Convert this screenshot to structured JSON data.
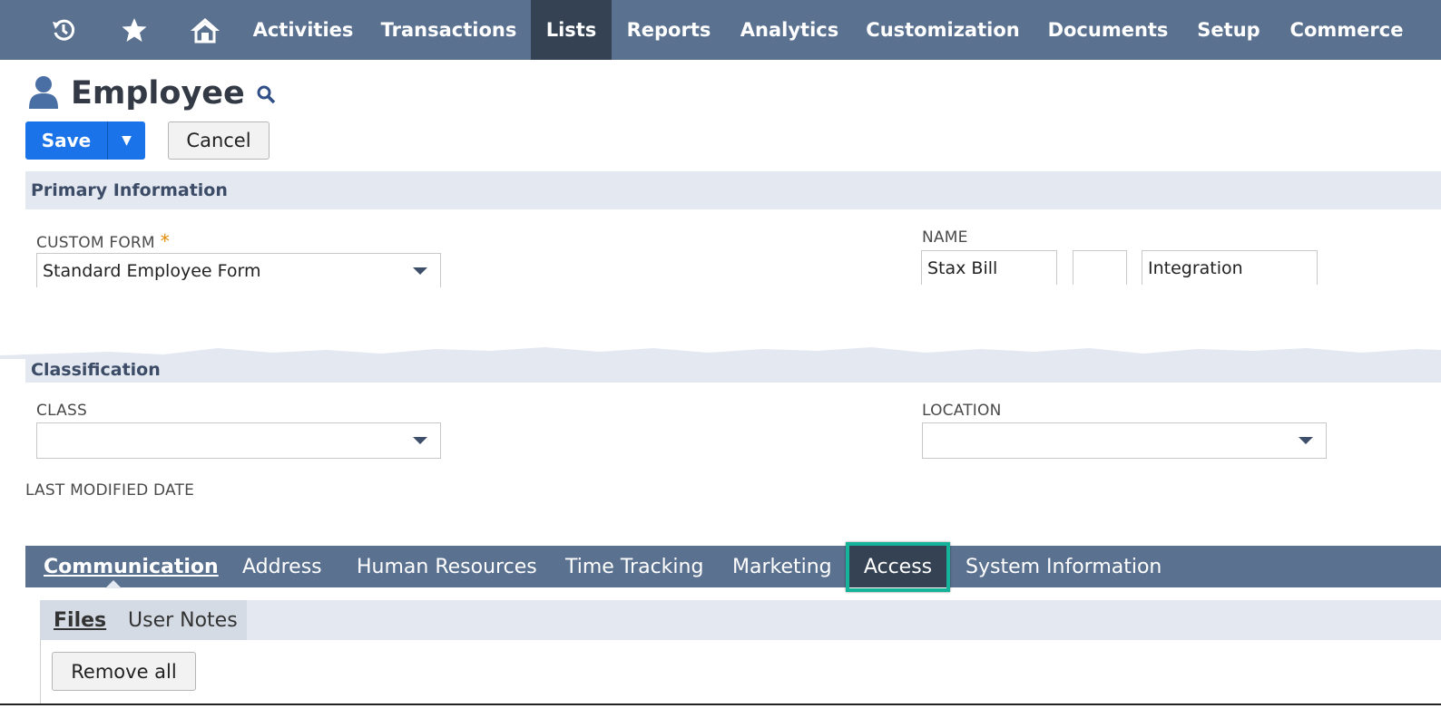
{
  "nav": {
    "icons": [
      "recent-history-icon",
      "star-icon",
      "home-icon"
    ],
    "items": [
      {
        "label": "Activities",
        "active": false
      },
      {
        "label": "Transactions",
        "active": false
      },
      {
        "label": "Lists",
        "active": true
      },
      {
        "label": "Reports",
        "active": false
      },
      {
        "label": "Analytics",
        "active": false
      },
      {
        "label": "Customization",
        "active": false
      },
      {
        "label": "Documents",
        "active": false
      },
      {
        "label": "Setup",
        "active": false
      },
      {
        "label": "Commerce",
        "active": false
      }
    ]
  },
  "page": {
    "title": "Employee",
    "title_icon": "employee-person-icon"
  },
  "toolbar": {
    "save_label": "Save",
    "cancel_label": "Cancel"
  },
  "primary_info": {
    "header": "Primary Information",
    "custom_form_label": "CUSTOM FORM",
    "required_mark": "*",
    "custom_form_value": "Standard Employee Form",
    "name_label": "NAME",
    "name_first": "Stax Bill",
    "name_middle": "",
    "name_last": "Integration"
  },
  "classification": {
    "header": "Classification",
    "class_label": "CLASS",
    "class_value": "",
    "location_label": "LOCATION",
    "location_value": "",
    "last_modified_label": "LAST MODIFIED DATE"
  },
  "tabs": [
    {
      "label": "Communication",
      "active": true
    },
    {
      "label": "Address",
      "active": false
    },
    {
      "label": "Human Resources",
      "active": false
    },
    {
      "label": "Time Tracking",
      "active": false
    },
    {
      "label": "Marketing",
      "active": false
    },
    {
      "label": "Access",
      "active": false,
      "highlighted": true
    },
    {
      "label": "System Information",
      "active": false
    }
  ],
  "subtabs": [
    {
      "label": "Files",
      "active": true
    },
    {
      "label": "User Notes",
      "active": false
    }
  ],
  "files": {
    "remove_all_label": "Remove all"
  },
  "colors": {
    "nav_bg": "#5b7190",
    "nav_active": "#344254",
    "primary_button": "#1a73e8",
    "section_bg": "#e3e8f1",
    "highlight": "#14b39a"
  }
}
